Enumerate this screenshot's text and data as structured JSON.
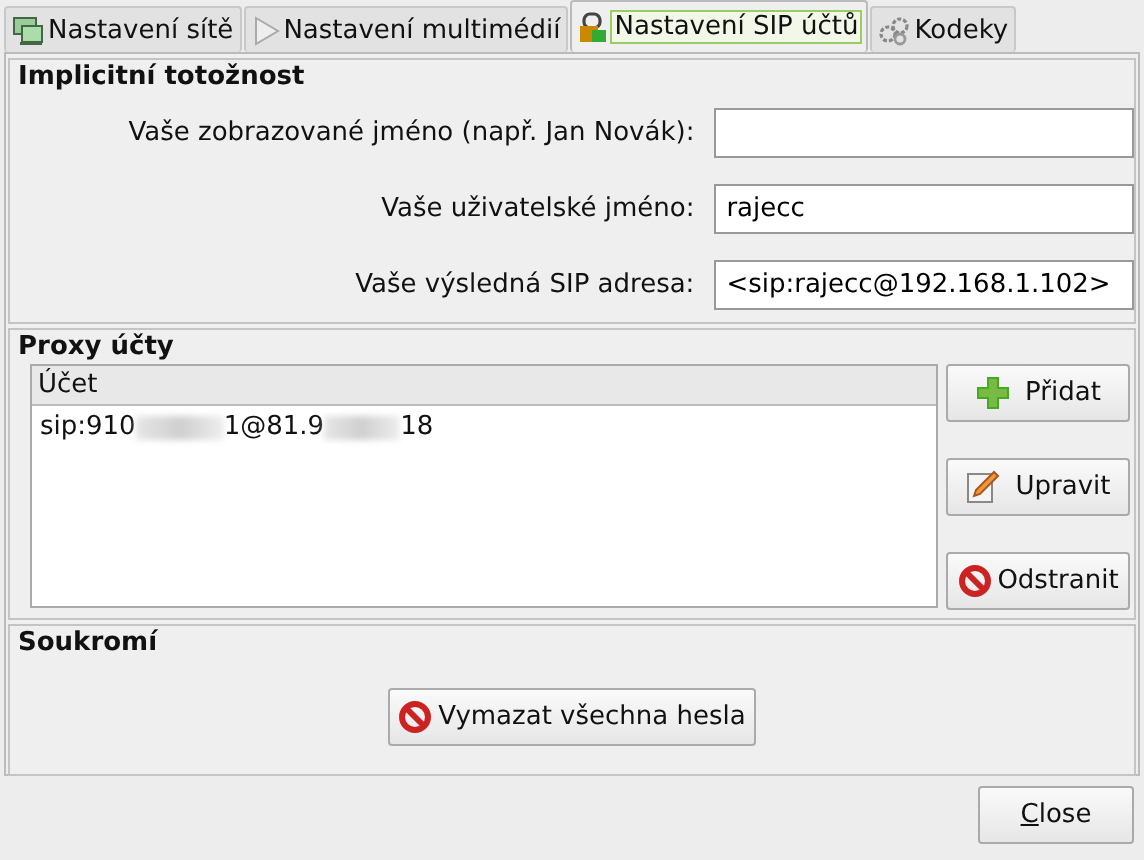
{
  "tabs": [
    {
      "label": "Nastavení sítě",
      "kind": "network",
      "selected": false
    },
    {
      "label": "Nastavení multimédií",
      "kind": "play",
      "selected": false
    },
    {
      "label": "Nastavení SIP účtů",
      "kind": "lock",
      "selected": true
    },
    {
      "label": "Kodeky",
      "kind": "gears",
      "selected": false
    }
  ],
  "identity": {
    "title": "Implicitní totožnost",
    "fields": [
      {
        "label": "Vaše zobrazované jméno (např. Jan Novák):"
      },
      {
        "label": "Vaše uživatelské jméno:",
        "value": "rajecc"
      },
      {
        "label": "Vaše výsledná SIP adresa:",
        "value": "<sip:rajecc@192.168.1.102>"
      }
    ]
  },
  "proxy": {
    "title": "Proxy účty",
    "column": "Účet",
    "rows": [
      {
        "visible_parts": [
          "sip:910",
          "1@81.9",
          "18"
        ]
      }
    ],
    "buttons": [
      {
        "label": "Přidat",
        "kind": "plus"
      },
      {
        "label": "Upravit",
        "kind": "edit"
      },
      {
        "label": "Odstranit",
        "kind": "forbid"
      }
    ]
  },
  "privacy": {
    "title": "Soukromí",
    "button": {
      "label": "Vymazat všechna hesla",
      "kind": "forbid"
    }
  },
  "close_button": {
    "mnemonic": "C",
    "rest": "lose"
  }
}
